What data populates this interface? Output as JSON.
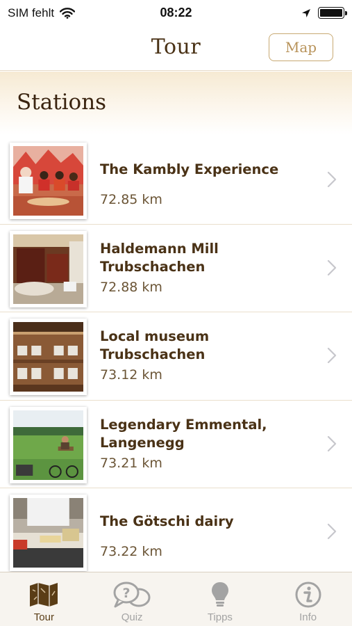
{
  "status": {
    "carrier": "SIM fehlt",
    "time": "08:22"
  },
  "nav": {
    "title": "Tour",
    "map_label": "Map"
  },
  "section": {
    "title": "Stations"
  },
  "stations": [
    {
      "title": "The Kambly Experience",
      "distance": "72.85 km"
    },
    {
      "title": "Haldemann Mill Trubschachen",
      "distance": "72.88 km"
    },
    {
      "title": "Local museum Trubschachen",
      "distance": "73.12 km"
    },
    {
      "title": "Legendary Emmental, Langenegg",
      "distance": "73.21 km"
    },
    {
      "title": "The Götschi dairy",
      "distance": "73.22 km"
    }
  ],
  "tabs": [
    {
      "label": "Tour",
      "icon": "map-icon",
      "active": true
    },
    {
      "label": "Quiz",
      "icon": "question-bubble-icon",
      "active": false
    },
    {
      "label": "Tipps",
      "icon": "lightbulb-icon",
      "active": false
    },
    {
      "label": "Info",
      "icon": "info-icon",
      "active": false
    }
  ],
  "colors": {
    "accent": "#4a3216",
    "button_border": "#c8a972",
    "header_tint": "#f6ead3",
    "inactive_tab": "#a3a3a3"
  }
}
